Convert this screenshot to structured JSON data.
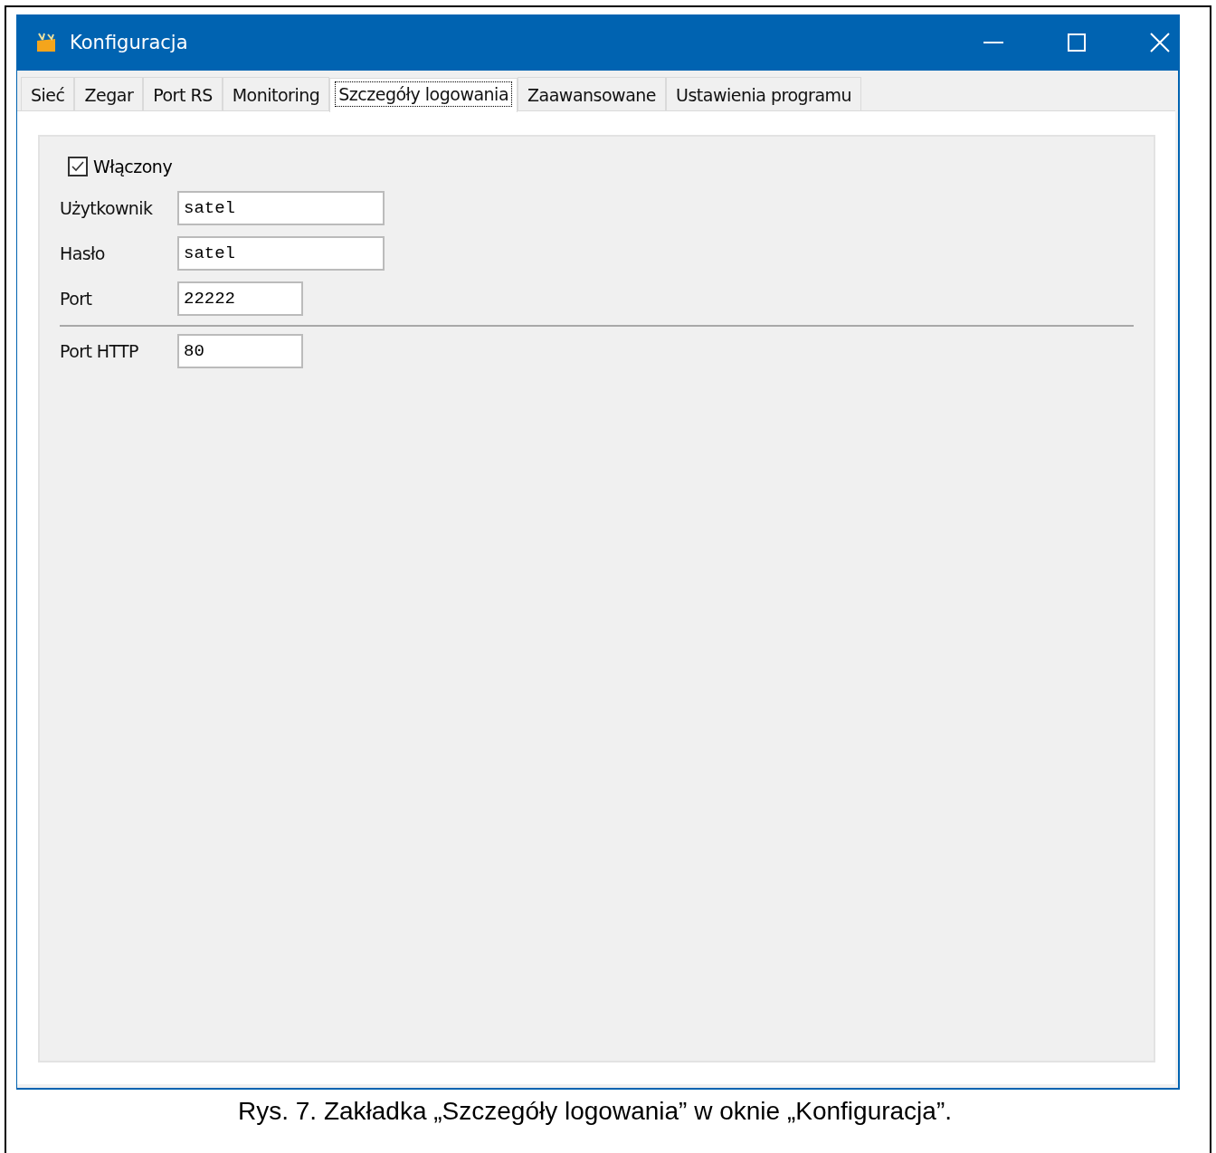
{
  "window": {
    "title": "Konfiguracja"
  },
  "tabs": [
    {
      "label": "Sieć",
      "selected": false
    },
    {
      "label": "Zegar",
      "selected": false
    },
    {
      "label": "Port RS",
      "selected": false
    },
    {
      "label": "Monitoring",
      "selected": false
    },
    {
      "label": "Szczegóły logowania",
      "selected": true
    },
    {
      "label": "Zaawansowane",
      "selected": false
    },
    {
      "label": "Ustawienia programu",
      "selected": false
    }
  ],
  "enabled": {
    "label": "Włączony",
    "checked": true
  },
  "sections": [
    [
      {
        "label": "Użytkownik",
        "value": "satel",
        "kind": "wide"
      },
      {
        "label": "Hasło",
        "value": "satel",
        "kind": "wide"
      },
      {
        "label": "Port",
        "value": "22222",
        "kind": "narrow"
      }
    ],
    [
      {
        "label": "Port HTTP",
        "value": "80",
        "kind": "narrow"
      }
    ]
  ],
  "caption": "Rys. 7. Zakładka „Szczegóły logowania” w oknie „Konfiguracja”."
}
